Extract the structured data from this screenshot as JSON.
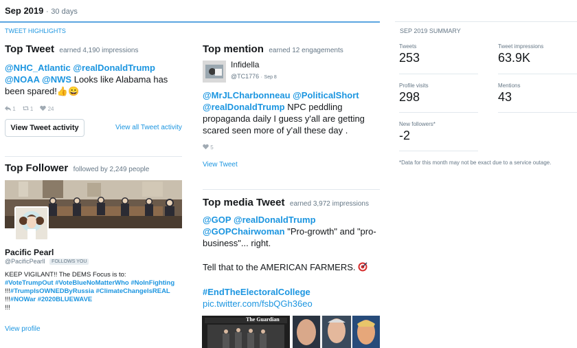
{
  "header": {
    "month": "Sep 2019",
    "separator": "·",
    "period": "30 days"
  },
  "highlights_label": "TWEET HIGHLIGHTS",
  "top_tweet": {
    "title": "Top Tweet",
    "subtitle": "earned 4,190 impressions",
    "mentions": "@NHC_Atlantic @realDonaldTrump @NOAA @NWS",
    "text": "Looks like Alabama has been spared!",
    "emoji": "👍😀",
    "replies": "1",
    "retweets": "1",
    "likes": "24",
    "activity_button": "View Tweet activity",
    "view_all_link": "View all Tweet activity"
  },
  "top_follower": {
    "title": "Top Follower",
    "subtitle": "followed by 2,249 people",
    "name": "Pacific Pearl",
    "handle": "@PacificPearll",
    "badge": "FOLLOWS YOU",
    "bio_text": "KEEP VIGILANT!! The DEMS Focus is to:",
    "bio_tags": "#VoteTrumpOut #VoteBlueNoMatterWho #NoInFighting",
    "bio_bang_1": "!!!",
    "bio_tag_3": "#TrumpIsOWNEDByRussia",
    "bio_tag_4": "#ClimateChangeIsREAL",
    "bio_bang_2": "!!!",
    "bio_tag_5": "#NOWar #2020BLUEWAVE",
    "bio_end": "!!!",
    "view_profile": "View profile"
  },
  "top_mention": {
    "title": "Top mention",
    "subtitle": "earned 12 engagements",
    "author_name": "Infidella",
    "author_handle": "@TC1776",
    "date": "Sep 8",
    "mentions": "@MrJLCharbonneau @PoliticalShort @realDonaldTrump",
    "text": "NPC peddling propaganda daily I guess y'all are getting scared seen more of y'all these day .",
    "likes": "5",
    "view_tweet": "View Tweet"
  },
  "top_media": {
    "title": "Top media Tweet",
    "subtitle": "earned 3,972 impressions",
    "mentions": "@GOP @realDonaldTrump @GOPChairwoman",
    "text": "\"Pro-growth\" and \"pro-business\"... right.",
    "line2": "Tell that to the AMERICAN FARMERS.",
    "hashtag": "#EndTheElectoralCollege",
    "link": "pic.twitter.com/fsbQGh36eo",
    "photo_caption": "The Guardian"
  },
  "summary": {
    "label": "SEP 2019 SUMMARY",
    "tweets_label": "Tweets",
    "tweets_value": "253",
    "impressions_label": "Tweet impressions",
    "impressions_value": "63.9K",
    "visits_label": "Profile visits",
    "visits_value": "298",
    "mentions_label": "Mentions",
    "mentions_value": "43",
    "followers_label": "New followers*",
    "followers_value": "-2",
    "note": "*Data for this month may not be exact due to a service outage."
  },
  "colors": {
    "link": "#1b95e0",
    "muted": "#657786",
    "accent_line": "#5aa5e0"
  }
}
